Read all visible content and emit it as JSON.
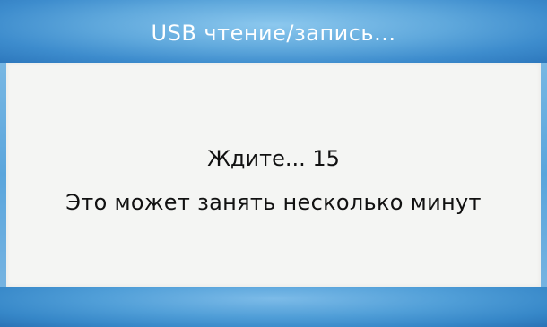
{
  "window": {
    "title": "USB чтение/запись..."
  },
  "dialog": {
    "wait_label": "Ждите...",
    "countdown": "15",
    "message": "Это может занять несколько минут"
  }
}
